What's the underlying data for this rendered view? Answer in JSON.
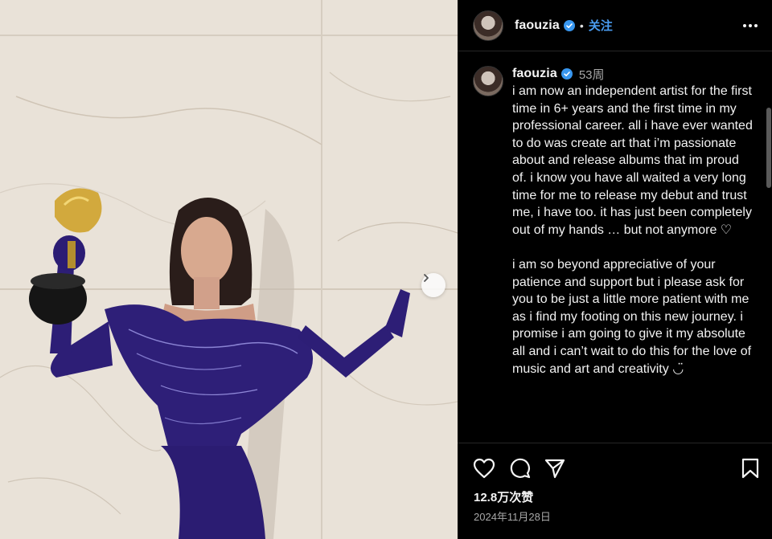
{
  "post": {
    "username": "faouzia",
    "follow_label": "关注",
    "more_icon": "more-horizontal-icon",
    "verified_icon": "verified-badge-icon",
    "colors": {
      "accent": "#4a9cf0",
      "background": "#000000",
      "muted": "#a8a8a8"
    }
  },
  "comment": {
    "username": "faouzia",
    "time": "53周",
    "caption": "i am now an independent artist for the first time in 6+ years and the first time in my professional career. all i have ever wanted to do was create art that i’m passionate about and release albums that im proud of. i know you have all waited a very long time for me to release my debut and trust me, i have too. it has just been completely out of my hands … but not anymore ♡\n\ni am so beyond appreciative of your patience and support but i please ask for you to be just a little more patient with me as i find my footing on this new journey. i promise i am going to give it my absolute all and i can’t wait to do this for the love of music and art and creativity ◡̈"
  },
  "actions": {
    "icons": [
      "heart-icon",
      "comment-icon",
      "share-icon",
      "bookmark-icon"
    ],
    "likes": "12.8万次赞",
    "date": "2024年11月28日"
  },
  "media": {
    "next_icon": "chevron-right-icon"
  }
}
